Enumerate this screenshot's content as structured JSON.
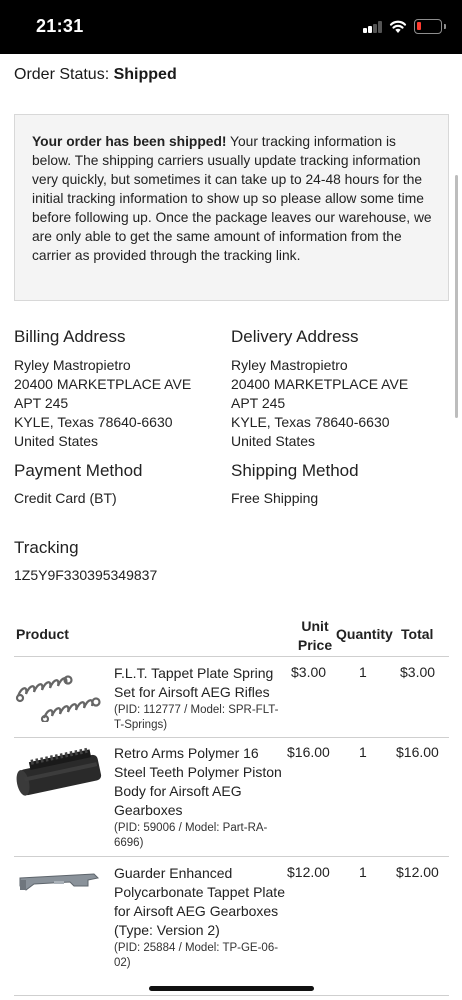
{
  "status_bar": {
    "time": "21:31",
    "battery_color": "#ff3b30"
  },
  "order": {
    "status_label": "Order Status:",
    "status_value": "Shipped"
  },
  "notice": {
    "lead": "Your order has been shipped!",
    "body": " Your tracking information is below. The shipping carriers usually update tracking information very quickly, but sometimes it can take up to 24-48 hours for the initial tracking information to show up so please allow some time before following up. Once the package leaves our warehouse, we are only able to get the same amount of information from the carrier as provided through the tracking link."
  },
  "billing": {
    "heading": "Billing Address",
    "lines": [
      "Ryley Mastropietro",
      "20400 MARKETPLACE AVE",
      "APT 245",
      "KYLE, Texas 78640-6630",
      "United States"
    ]
  },
  "delivery": {
    "heading": "Delivery Address",
    "lines": [
      "Ryley Mastropietro",
      "20400 MARKETPLACE AVE",
      "APT 245",
      "KYLE, Texas 78640-6630",
      "United States"
    ]
  },
  "payment": {
    "heading": "Payment Method",
    "value": "Credit Card (BT)"
  },
  "shipping": {
    "heading": "Shipping Method",
    "value": "Free Shipping"
  },
  "tracking": {
    "heading": "Tracking",
    "number": "1Z5Y9F330395349837"
  },
  "table": {
    "headers": {
      "product": "Product",
      "unit_price_1": "Unit",
      "unit_price_2": "Price",
      "quantity": "Quantity",
      "total": "Total"
    },
    "rows": [
      {
        "name": "F.L.T. Tappet Plate Spring Set for Airsoft AEG Rifles",
        "meta": "(PID: 112777 / Model: SPR-FLT-T-Springs)",
        "price": "$3.00",
        "qty": "1",
        "total": "$3.00",
        "icon": "spring-icon"
      },
      {
        "name": "Retro Arms Polymer 16 Steel Teeth Polymer Piston Body for Airsoft AEG Gearboxes",
        "meta": "(PID: 59006 / Model: Part-RA-6696)",
        "price": "$16.00",
        "qty": "1",
        "total": "$16.00",
        "icon": "piston-icon"
      },
      {
        "name": "Guarder Enhanced Polycarbonate Tappet Plate for Airsoft AEG Gearboxes (Type: Version 2)",
        "meta": "(PID: 25884 / Model: TP-GE-06-02)",
        "price": "$12.00",
        "qty": "1",
        "total": "$12.00",
        "icon": "tappet-plate-icon"
      }
    ]
  }
}
